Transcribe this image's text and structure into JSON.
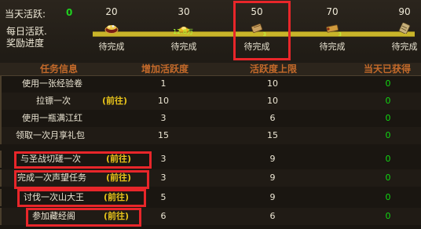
{
  "header": {
    "today_label": "当天活跃:",
    "today_value": "0",
    "daily_label_line1": "每日活跃.",
    "daily_label_line2": "奖励进度"
  },
  "milestones": [
    {
      "value": "20",
      "icon": "treasure-bowl-icon",
      "icon_text": "",
      "icon_count": "",
      "status": "待完成"
    },
    {
      "value": "30",
      "icon": "gold-ingot-icon",
      "icon_text": "12.8万",
      "icon_count": "",
      "status": "待完成"
    },
    {
      "value": "50",
      "icon": "scroll-icon",
      "icon_text": "",
      "icon_count": "3",
      "status": "待完成"
    },
    {
      "value": "70",
      "icon": "scroll-icon",
      "icon_text": "",
      "icon_count": "3",
      "status": "待完成"
    },
    {
      "value": "90",
      "icon": "scroll-bundle-icon",
      "icon_text": "",
      "icon_count": "",
      "status": "待完成"
    }
  ],
  "table": {
    "headers": [
      "任务信息",
      "增加活跃度",
      "活跃度上限",
      "当天已获得"
    ],
    "goto_label": "(前往)",
    "rows": [
      {
        "name": "使用一张经验卷",
        "goto": false,
        "add": "1",
        "limit": "10",
        "got": "0"
      },
      {
        "name": "拉镖一次",
        "goto": true,
        "add": "10",
        "limit": "10",
        "got": "0"
      },
      {
        "name": "使用一瓶满江红",
        "goto": false,
        "add": "3",
        "limit": "6",
        "got": "0"
      },
      {
        "name": "领取一次月享礼包",
        "goto": false,
        "add": "15",
        "limit": "15",
        "got": "0"
      },
      {
        "name": "与圣战切磋一次",
        "goto": true,
        "add": "3",
        "limit": "9",
        "got": "0"
      },
      {
        "name": "完成一次声望任务",
        "goto": true,
        "add": "3",
        "limit": "9",
        "got": "0"
      },
      {
        "name": "讨伐一次山大王",
        "goto": true,
        "add": "5",
        "limit": "9",
        "got": "0"
      },
      {
        "name": "参加藏经阁",
        "goto": true,
        "add": "6",
        "limit": "6",
        "got": "0"
      }
    ]
  },
  "colors": {
    "accent_green": "#1fd11f",
    "header_orange": "#c46a2a",
    "goto_yellow": "#e6c21a",
    "highlight_red": "#e8262a"
  }
}
